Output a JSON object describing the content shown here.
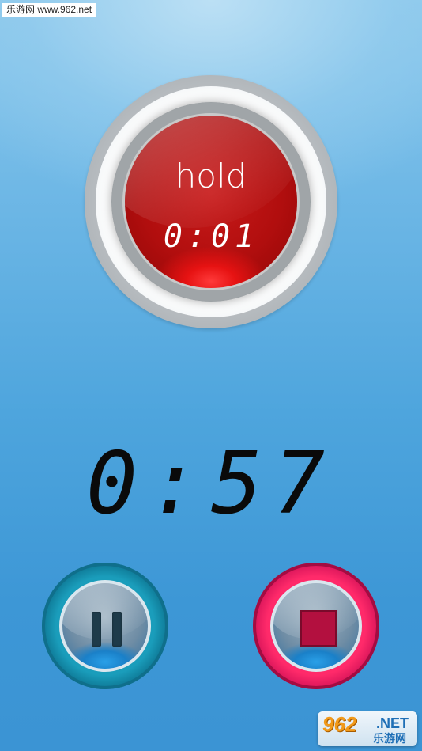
{
  "watermark_top": {
    "text": "乐游网 www.962.net"
  },
  "hold_button": {
    "label": "hold",
    "timer": "0:01"
  },
  "countdown": {
    "value": "0:57"
  },
  "controls": {
    "pause_icon": "pause-icon",
    "stop_icon": "stop-icon"
  },
  "watermark_bottom": {
    "logo_number": "962",
    "logo_domain": ".NET",
    "logo_cn": "乐游网"
  },
  "colors": {
    "hold_red": "#b10e0e",
    "pause_teal": "#1a9dbb",
    "stop_pink": "#ff2a6a",
    "background_blue": "#4ea5dd"
  }
}
